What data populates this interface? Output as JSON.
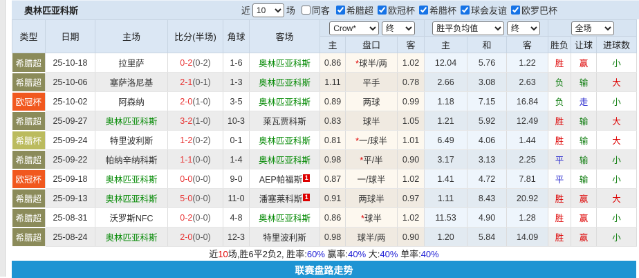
{
  "topbar": {
    "title": "奥林匹亚科斯",
    "near_label": "近",
    "near_value": "10",
    "games_label": "场",
    "same_venue": {
      "label": "同客",
      "checked": false
    },
    "league_filters": [
      {
        "label": "希腊超",
        "checked": true
      },
      {
        "label": "欧冠杯",
        "checked": true
      },
      {
        "label": "希腊杯",
        "checked": true
      },
      {
        "label": "球会友谊",
        "checked": true
      },
      {
        "label": "欧罗巴杯",
        "checked": true
      }
    ]
  },
  "table": {
    "headers_left": [
      "类型",
      "日期",
      "主场",
      "比分(半场)",
      "角球",
      "客场"
    ],
    "selects": {
      "odds_source": "Crow*",
      "odds_final1": "终",
      "avg_source": "胜平负均值",
      "odds_final2": "终",
      "scope": "全场"
    },
    "headers_sub": [
      "主",
      "盘口",
      "客",
      "主",
      "和",
      "客",
      "胜负",
      "让球",
      "进球数"
    ],
    "rows": [
      {
        "type": "希腊超",
        "type_key": "super",
        "date": "25-10-18",
        "home": "拉里萨",
        "home_hl": false,
        "ft": "0-2",
        "ht": "(0-2)",
        "corners": "1-6",
        "away": "奥林匹亚科斯",
        "away_hl": true,
        "away_red": "",
        "o_home": "0.86",
        "handicap": "球半/两",
        "star": true,
        "o_away": "1.02",
        "avg_home": "12.04",
        "avg_draw": "5.76",
        "avg_away": "1.22",
        "res": "胜",
        "res_c": "r",
        "han": "赢",
        "han_c": "r",
        "goal": "小",
        "goal_c": "g"
      },
      {
        "type": "希腊超",
        "type_key": "super",
        "date": "25-10-06",
        "home": "塞萨洛尼基",
        "home_hl": false,
        "ft": "2-1",
        "ht": "(0-1)",
        "corners": "1-3",
        "away": "奥林匹亚科斯",
        "away_hl": true,
        "away_red": "",
        "o_home": "1.11",
        "handicap": "平手",
        "star": false,
        "o_away": "0.78",
        "avg_home": "2.66",
        "avg_draw": "3.08",
        "avg_away": "2.63",
        "res": "负",
        "res_c": "g",
        "han": "输",
        "han_c": "g",
        "goal": "大",
        "goal_c": "r"
      },
      {
        "type": "欧冠杯",
        "type_key": "ucl",
        "date": "25-10-02",
        "home": "阿森纳",
        "home_hl": false,
        "ft": "2-0",
        "ht": "(1-0)",
        "corners": "3-5",
        "away": "奥林匹亚科斯",
        "away_hl": true,
        "away_red": "",
        "o_home": "0.89",
        "handicap": "两球",
        "star": false,
        "o_away": "0.99",
        "avg_home": "1.18",
        "avg_draw": "7.15",
        "avg_away": "16.84",
        "res": "负",
        "res_c": "g",
        "han": "走",
        "han_c": "b",
        "goal": "小",
        "goal_c": "g"
      },
      {
        "type": "希腊超",
        "type_key": "super",
        "date": "25-09-27",
        "home": "奥林匹亚科斯",
        "home_hl": true,
        "ft": "3-2",
        "ht": "(1-0)",
        "corners": "10-3",
        "away": "莱瓦贾科斯",
        "away_hl": false,
        "away_red": "",
        "o_home": "0.83",
        "handicap": "球半",
        "star": false,
        "o_away": "1.05",
        "avg_home": "1.21",
        "avg_draw": "5.92",
        "avg_away": "12.49",
        "res": "胜",
        "res_c": "r",
        "han": "输",
        "han_c": "g",
        "goal": "大",
        "goal_c": "r"
      },
      {
        "type": "希腊杯",
        "type_key": "cup",
        "date": "25-09-24",
        "home": "特里波利斯",
        "home_hl": false,
        "ft": "1-2",
        "ht": "(0-2)",
        "corners": "0-1",
        "away": "奥林匹亚科斯",
        "away_hl": true,
        "away_red": "",
        "o_home": "0.81",
        "handicap": "一/球半",
        "star": true,
        "o_away": "1.01",
        "avg_home": "6.49",
        "avg_draw": "4.06",
        "avg_away": "1.44",
        "res": "胜",
        "res_c": "r",
        "han": "输",
        "han_c": "g",
        "goal": "大",
        "goal_c": "r"
      },
      {
        "type": "希腊超",
        "type_key": "super",
        "date": "25-09-22",
        "home": "帕纳辛纳科斯",
        "home_hl": false,
        "ft": "1-1",
        "ht": "(0-0)",
        "corners": "1-4",
        "away": "奥林匹亚科斯",
        "away_hl": true,
        "away_red": "",
        "o_home": "0.98",
        "handicap": "平/半",
        "star": true,
        "o_away": "0.90",
        "avg_home": "3.17",
        "avg_draw": "3.13",
        "avg_away": "2.25",
        "res": "平",
        "res_c": "b",
        "han": "输",
        "han_c": "g",
        "goal": "小",
        "goal_c": "g"
      },
      {
        "type": "欧冠杯",
        "type_key": "ucl",
        "date": "25-09-18",
        "home": "奥林匹亚科斯",
        "home_hl": true,
        "ft": "0-0",
        "ht": "(0-0)",
        "corners": "9-0",
        "away": "AEP帕福斯",
        "away_hl": false,
        "away_red": "1",
        "o_home": "0.87",
        "handicap": "一/球半",
        "star": false,
        "o_away": "1.02",
        "avg_home": "1.41",
        "avg_draw": "4.72",
        "avg_away": "7.81",
        "res": "平",
        "res_c": "b",
        "han": "输",
        "han_c": "g",
        "goal": "小",
        "goal_c": "g"
      },
      {
        "type": "希腊超",
        "type_key": "super",
        "date": "25-09-13",
        "home": "奥林匹亚科斯",
        "home_hl": true,
        "ft": "5-0",
        "ht": "(0-0)",
        "corners": "11-0",
        "away": "潘塞莱科斯",
        "away_hl": false,
        "away_red": "1",
        "o_home": "0.91",
        "handicap": "两球半",
        "star": false,
        "o_away": "0.97",
        "avg_home": "1.11",
        "avg_draw": "8.43",
        "avg_away": "20.92",
        "res": "胜",
        "res_c": "r",
        "han": "赢",
        "han_c": "r",
        "goal": "大",
        "goal_c": "r"
      },
      {
        "type": "希腊超",
        "type_key": "super",
        "date": "25-08-31",
        "home": "沃罗斯NFC",
        "home_hl": false,
        "ft": "0-2",
        "ht": "(0-0)",
        "corners": "4-8",
        "away": "奥林匹亚科斯",
        "away_hl": true,
        "away_red": "",
        "o_home": "0.86",
        "handicap": "球半",
        "star": true,
        "o_away": "1.02",
        "avg_home": "11.53",
        "avg_draw": "4.90",
        "avg_away": "1.28",
        "res": "胜",
        "res_c": "r",
        "han": "赢",
        "han_c": "r",
        "goal": "小",
        "goal_c": "g"
      },
      {
        "type": "希腊超",
        "type_key": "super",
        "date": "25-08-24",
        "home": "奥林匹亚科斯",
        "home_hl": true,
        "ft": "2-0",
        "ht": "(0-0)",
        "corners": "12-3",
        "away": "特里波利斯",
        "away_hl": false,
        "away_red": "",
        "o_home": "0.98",
        "handicap": "球半/两",
        "star": false,
        "o_away": "0.90",
        "avg_home": "1.20",
        "avg_draw": "5.84",
        "avg_away": "14.09",
        "res": "胜",
        "res_c": "r",
        "han": "赢",
        "han_c": "r",
        "goal": "小",
        "goal_c": "g"
      }
    ]
  },
  "summary_parts": [
    {
      "t": "近",
      "c": "k"
    },
    {
      "t": "10",
      "c": "r"
    },
    {
      "t": "场,胜6平2负2, 胜率:",
      "c": "k"
    },
    {
      "t": "60%",
      "c": "b"
    },
    {
      "t": " 赢率:",
      "c": "k"
    },
    {
      "t": "40%",
      "c": "b"
    },
    {
      "t": " 大:",
      "c": "k"
    },
    {
      "t": "40%",
      "c": "b"
    },
    {
      "t": " 单率:",
      "c": "k"
    },
    {
      "t": "40%",
      "c": "b"
    }
  ],
  "footer": {
    "label": "联赛盘路走势"
  },
  "colors": {
    "accent_blue": "#1e94d3",
    "badge_super": "#8b8b5a",
    "badge_ucl": "#f1581e",
    "badge_cup": "#bbbb5e",
    "win_red": "#dd0000",
    "lose_green": "#0f7d0f",
    "draw_blue": "#2222cc",
    "team_green": "#008800"
  }
}
